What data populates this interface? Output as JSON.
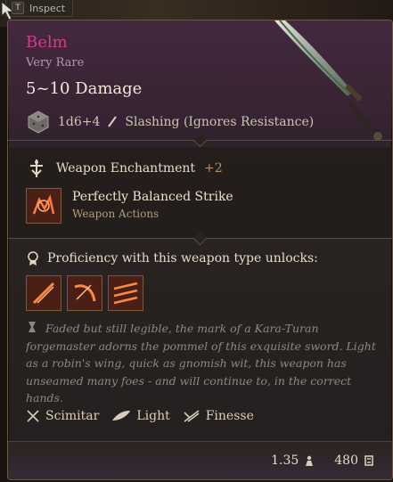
{
  "hint": {
    "key": "T",
    "label": "Inspect"
  },
  "item": {
    "name": "Belm",
    "rarity": "Very Rare",
    "damage": "5~10 Damage",
    "damage_dice": "1d6+4",
    "damage_type": "Slashing (Ignores Resistance)"
  },
  "enchantment": {
    "label": "Weapon Enchantment",
    "bonus": "+2"
  },
  "action": {
    "title": "Perfectly Balanced Strike",
    "subtitle": "Weapon Actions"
  },
  "proficiency": {
    "label": "Proficiency with this weapon type unlocks:",
    "icons": [
      "slash-attack-icon",
      "cleave-attack-icon",
      "flurry-attack-icon"
    ]
  },
  "flavor": "Faded but still legible, the mark of a Kara-Turan forgemaster adorns the pommel of this exquisite sword. Light as a robin's wing, quick as gnomish wit, this weapon has unseamed many foes - and will continue to, in the correct hands.",
  "properties": [
    {
      "label": "Scimitar",
      "icon": "scimitar-icon"
    },
    {
      "label": "Light",
      "icon": "feather-icon"
    },
    {
      "label": "Finesse",
      "icon": "finesse-icon"
    }
  ],
  "footer": {
    "weight": "1.35",
    "price": "480"
  },
  "colors": {
    "name": "#d23a8a",
    "rarity": "#b996b4",
    "bonus": "#b9916a"
  }
}
